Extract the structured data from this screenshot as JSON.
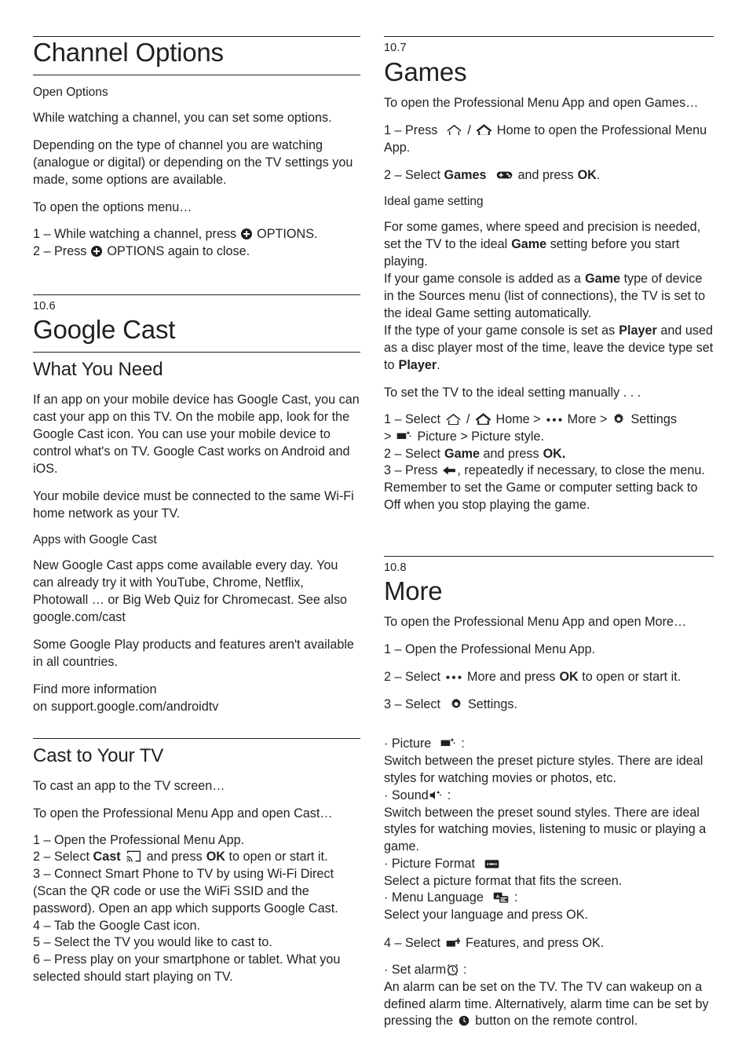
{
  "left_column": {
    "channel_options": {
      "heading": "Channel Options",
      "subheading": "Open Options",
      "para1": "While watching a channel, you can set some options.",
      "para2": "Depending on the type of channel you are watching (analogue or digital) or depending on the TV settings you made, some options are available.",
      "para3": "To open the options menu…",
      "step1_pre": "1 –  While watching a channel, press",
      "step1_post": "OPTIONS.",
      "step2_pre": "2 –  Press",
      "step2_post": "OPTIONS again to close."
    },
    "google_cast": {
      "section_number": "10.6",
      "heading": "Google Cast",
      "what_you_need": {
        "heading": "What You Need",
        "para1": "If an app on your mobile device has Google Cast, you can cast your app on this TV. On the mobile app, look for the Google Cast icon. You can use your mobile device to control what's on TV. Google Cast works on Android and iOS.",
        "para2": "Your mobile device must be connected to the same Wi-Fi home network as your TV."
      },
      "apps_with_cast": {
        "heading": "Apps with Google Cast",
        "para1": "New Google Cast apps come available every day. You can already try it with YouTube, Chrome, Netflix, Photowall … or Big Web Quiz for Chromecast. See also google.com/cast",
        "para2": "Some Google Play products and features aren't available in all countries.",
        "para3_line1": "Find more information",
        "para3_line2_pre": "on",
        "para3_link": "support.google.com/androidtv"
      },
      "cast_to_your_tv": {
        "heading": "Cast to Your TV",
        "para1": "To cast an app to the TV screen…",
        "para2": "To open the Professional Menu App and open Cast…",
        "step1": "1 –  Open the Professional Menu App.",
        "step2_pre": "2 –  Select",
        "step2_bold": "Cast",
        "step2_mid": "and press",
        "step2_ok": "OK",
        "step2_post": "to open or start it.",
        "step3": "3 –  Connect Smart Phone to TV by using Wi-Fi Direct (Scan the QR code or use the WiFi SSID and the password). Open an app which supports Google Cast.",
        "step4": "4 –  Tab the Google Cast icon.",
        "step5": "5 –  Select the TV you would like to cast to.",
        "step6": "6 –  Press play on your smartphone or tablet. What you selected should start playing on TV."
      }
    }
  },
  "right_column": {
    "games": {
      "section_number": "10.7",
      "heading": "Games",
      "intro": "To open the Professional Menu App and open Games…",
      "step1_pre": "1 – Press",
      "step1_sep": "/",
      "step1_post": "Home to open the Professional Menu App.",
      "step2_pre": "2 – Select",
      "step2_bold": "Games",
      "step2_mid": "and press",
      "step2_ok": "OK",
      "step2_post": ".",
      "ideal": {
        "heading": "Ideal game setting",
        "p1_a": "For some games, where speed and precision is needed, set the TV to the ideal",
        "p1_b": "Game",
        "p1_c": "setting before you start playing.",
        "p2_a": "If your game console is added as a",
        "p2_b": "Game",
        "p2_c": "type of device in the Sources menu (list of connections), the TV is set to the ideal Game setting automatically.",
        "p3_a": "If the type of your game console is set as",
        "p3_b": "Player",
        "p3_c": "and used as a disc player most of the time, leave the device type set to",
        "p3_d": "Player",
        "p3_e": ".",
        "manual_intro": "To set the TV to the ideal setting manually . . .",
        "step1_a": "1 –  Select",
        "step1_sep": "/",
        "step1_b": "Home >",
        "step1_more": "More >",
        "step1_settings": "Settings",
        "step1_c": ">",
        "step1_d": "Picture > Picture style.",
        "step2_a": "2 –  Select",
        "step2_bold": "Game",
        "step2_b": "and press",
        "step2_ok": "OK.",
        "step3_a": "3 –  Press",
        "step3_b": ", repeatedly if necessary, to close the menu. Remember to set the Game or computer setting back to Off when you stop playing the game."
      }
    },
    "more": {
      "section_number": "10.8",
      "heading": "More",
      "intro": "To open the Professional Menu App and open More…",
      "step1": "1 – Open the Professional Menu App.",
      "step2_pre": "2 – Select",
      "step2_mid": "More and press",
      "step2_ok": "OK",
      "step2_post": "to open or start it.",
      "step3_pre": "3 – Select",
      "step3_post": "Settings.",
      "bullets": [
        {
          "label": "· Picture",
          "icon": "picture-icon",
          "colon": ":",
          "desc": "Switch between the preset picture styles. There are ideal styles for watching movies or photos, etc."
        },
        {
          "label": "· Sound",
          "icon": "sound-icon",
          "colon": ":",
          "desc": "Switch between the preset sound styles. There are ideal styles for watching movies, listening to music or playing a game."
        },
        {
          "label": "· Picture Format",
          "icon": "picture-format-icon",
          "colon": "",
          "desc": "Select a picture format that fits the screen."
        },
        {
          "label": "· Menu Language",
          "icon": "menu-language-icon",
          "colon": ":",
          "desc": "Select your language and press OK."
        }
      ],
      "step4_pre": "4 – Select",
      "step4_post": "Features, and press OK.",
      "alarm": {
        "label": "· Set alarm",
        "colon": ":",
        "desc_a": "An alarm can be set on the TV. The TV can wakeup on a defined alarm time. Alternatively, alarm time can be set by pressing the",
        "desc_b": "button on the remote control."
      }
    }
  }
}
